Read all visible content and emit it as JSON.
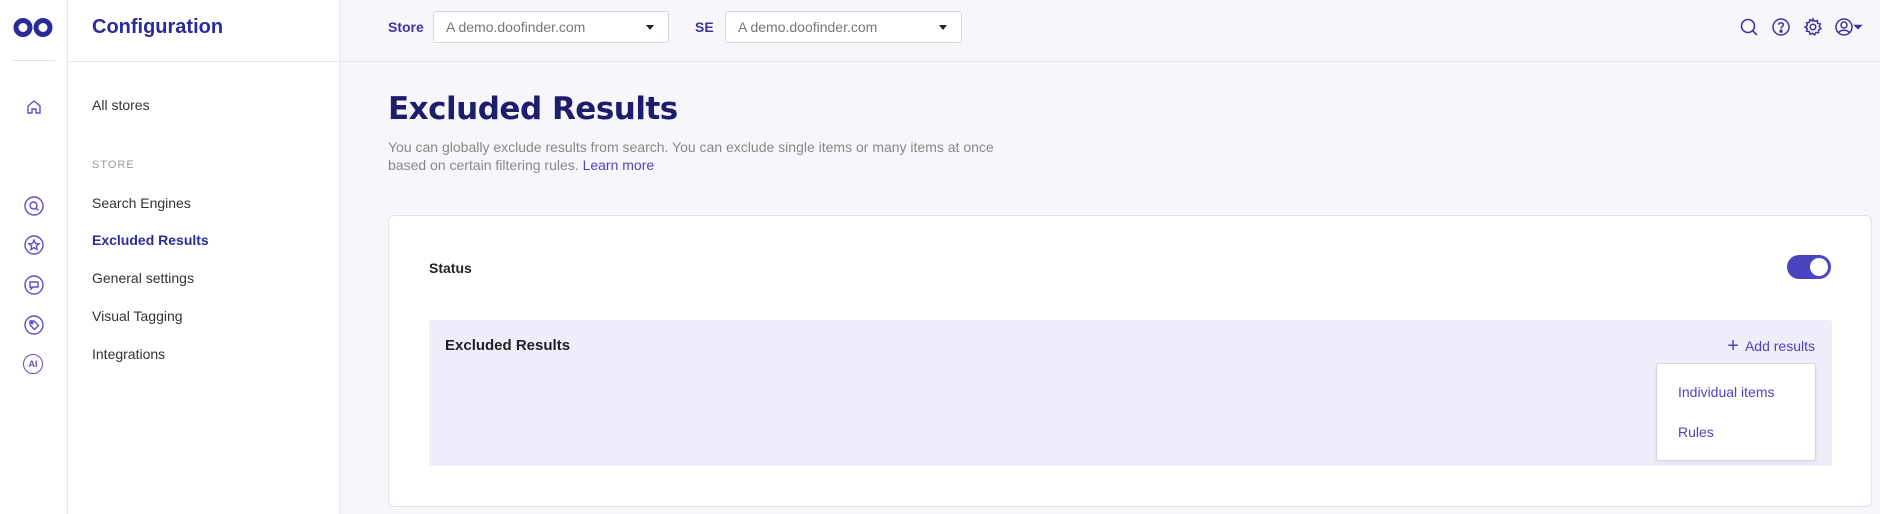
{
  "nav": {
    "title": "Configuration",
    "all_stores": "All stores",
    "section_label": "STORE",
    "items": [
      {
        "label": "Search Engines",
        "active": false
      },
      {
        "label": "Excluded Results",
        "active": true
      },
      {
        "label": "General settings",
        "active": false
      },
      {
        "label": "Visual Tagging",
        "active": false
      },
      {
        "label": "Integrations",
        "active": false
      }
    ]
  },
  "rail": {
    "icons": [
      "home-icon",
      "search-icon",
      "star-icon",
      "chat-icon",
      "tag-icon",
      "ai-icon"
    ],
    "ai_label": "AI"
  },
  "topbar": {
    "store_label": "Store",
    "store_value": "A demo.doofinder.com",
    "se_label": "SE",
    "se_value": "A demo.doofinder.com",
    "icons": [
      "search-icon",
      "help-icon",
      "settings-icon",
      "user-icon"
    ]
  },
  "main": {
    "title": "Excluded Results",
    "description": "You can globally exclude results from search. You can exclude single items or many items at once based on certain filtering rules.",
    "learn_more": "Learn more",
    "status_label": "Status",
    "status_enabled": true,
    "panel_title": "Excluded Results",
    "add_results": "Add results",
    "dropdown": {
      "individual_items": "Individual items",
      "rules": "Rules"
    }
  },
  "colors": {
    "accent": "#4b44c0",
    "title": "#1d1d6b",
    "panel_bg": "#eeeefb"
  }
}
